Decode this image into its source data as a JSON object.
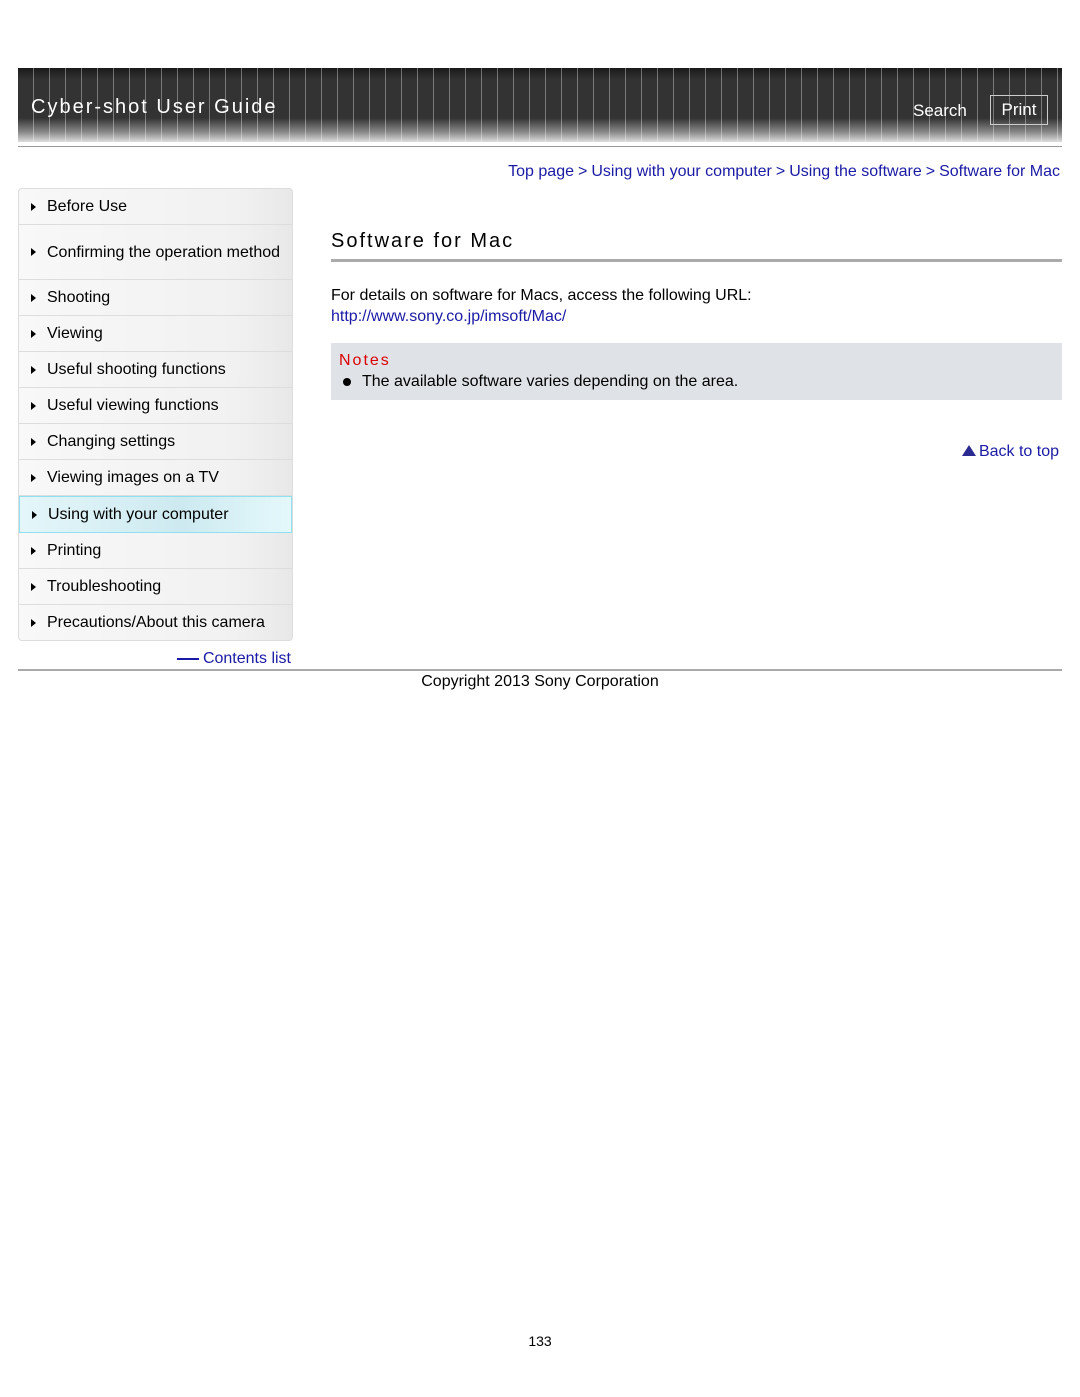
{
  "header": {
    "title": "Cyber-shot User Guide",
    "search": "Search",
    "print": "Print"
  },
  "breadcrumb": [
    "Top page",
    "Using with your computer",
    "Using the software",
    "Software for Mac"
  ],
  "breadcrumb_sep": ">",
  "nav": {
    "items": [
      "Before Use",
      "Confirming the operation method",
      "Shooting",
      "Viewing",
      "Useful shooting functions",
      "Useful viewing functions",
      "Changing settings",
      "Viewing images on a TV",
      "Using with your computer",
      "Printing",
      "Troubleshooting",
      "Precautions/About this camera"
    ],
    "active": "Using with your computer",
    "contents_list": "Contents list"
  },
  "main": {
    "title": "Software for Mac",
    "intro": "For details on software for Macs, access the following URL:",
    "url": "http://www.sony.co.jp/imsoft/Mac/",
    "notes_title": "Notes",
    "notes": [
      "The available software varies depending on the area."
    ],
    "back_to_top": "Back to top"
  },
  "footer": {
    "copyright": "Copyright 2013 Sony Corporation",
    "page_number": "133"
  }
}
